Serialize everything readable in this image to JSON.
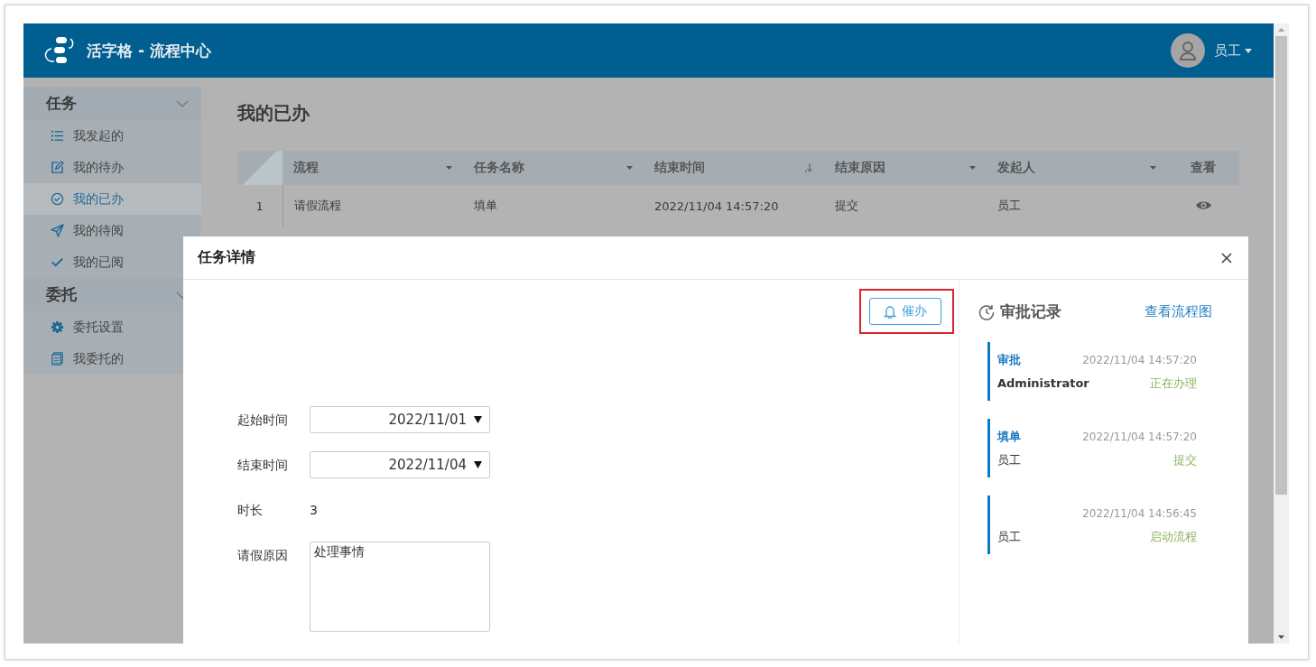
{
  "header": {
    "title": "活字格 - 流程中心",
    "user": "员工"
  },
  "sidebar": {
    "groups": [
      {
        "label": "任务",
        "expanded": true,
        "items": [
          {
            "label": "我发起的",
            "selected": false
          },
          {
            "label": "我的待办",
            "selected": false
          },
          {
            "label": "我的已办",
            "selected": true
          },
          {
            "label": "我的待阅",
            "selected": false
          },
          {
            "label": "我的已阅",
            "selected": false
          }
        ]
      },
      {
        "label": "委托",
        "expanded": true,
        "items": [
          {
            "label": "委托设置",
            "selected": false
          },
          {
            "label": "我委托的",
            "selected": false
          }
        ]
      }
    ]
  },
  "page": {
    "title": "我的已办",
    "table": {
      "columns": [
        {
          "label": "流程",
          "kind": "filter"
        },
        {
          "label": "任务名称",
          "kind": "filter"
        },
        {
          "label": "结束时间",
          "kind": "sorted"
        },
        {
          "label": "结束原因",
          "kind": "filter"
        },
        {
          "label": "发起人",
          "kind": "filter"
        },
        {
          "label": "查看",
          "kind": "action"
        }
      ],
      "rows": [
        {
          "index": "1",
          "cells": [
            "请假流程",
            "填单",
            "2022/11/04 14:57:20",
            "提交",
            "员工"
          ]
        }
      ]
    }
  },
  "dialog": {
    "title": "任务详情",
    "urge_button": {
      "label": "催办",
      "highlighted": true
    },
    "form": [
      {
        "kind": "date",
        "label": "起始时间",
        "value": "2022/11/01"
      },
      {
        "kind": "date",
        "label": "结束时间",
        "value": "2022/11/04"
      },
      {
        "kind": "text",
        "label": "时长",
        "value": "3"
      },
      {
        "kind": "textarea",
        "label": "请假原因",
        "value": "处理事情"
      }
    ],
    "history": {
      "title": "审批记录",
      "link": "查看流程图",
      "entries": [
        {
          "step": "审批",
          "time": "2022/11/04 14:57:20",
          "actor": "Administrator",
          "status": "正在办理"
        },
        {
          "step": "填单",
          "time": "2022/11/04 14:57:20",
          "actor": "员工",
          "status": "提交"
        },
        {
          "time": "2022/11/04 14:56:45",
          "actor": "员工",
          "status": "启动流程"
        }
      ]
    }
  }
}
